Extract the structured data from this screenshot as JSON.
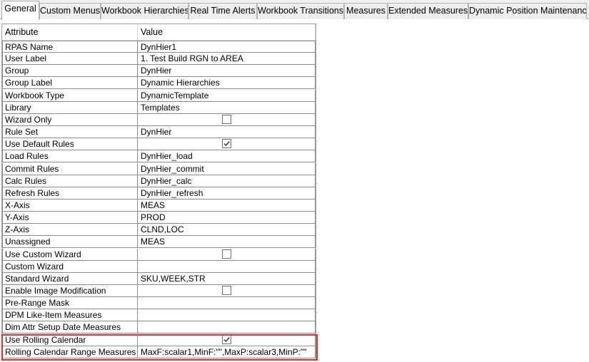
{
  "tabs": [
    {
      "label": "General",
      "active": true
    },
    {
      "label": "Custom Menus",
      "active": false
    },
    {
      "label": "Workbook Hierarchies",
      "active": false
    },
    {
      "label": "Real Time Alerts",
      "active": false
    },
    {
      "label": "Workbook Transitions",
      "active": false
    },
    {
      "label": "Measures",
      "active": false
    },
    {
      "label": "Extended Measures",
      "active": false
    },
    {
      "label": "Dynamic Position Maintenance",
      "active": false
    }
  ],
  "grid": {
    "columns": [
      "Attribute",
      "Value"
    ],
    "rows": [
      {
        "attribute": "RPAS Name",
        "value": "DynHier1"
      },
      {
        "attribute": "User Label",
        "value": "1.  Test Build RGN to AREA"
      },
      {
        "attribute": "Group",
        "value": "DynHier"
      },
      {
        "attribute": "Group Label",
        "value": "Dynamic Hierarchies"
      },
      {
        "attribute": "Workbook Type",
        "value": "DynamicTemplate"
      },
      {
        "attribute": "Library",
        "value": "Templates"
      },
      {
        "attribute": "Wizard Only",
        "checkbox": true,
        "checked": false
      },
      {
        "attribute": "Rule Set",
        "value": "DynHier"
      },
      {
        "attribute": "Use Default Rules",
        "checkbox": true,
        "checked": true
      },
      {
        "attribute": "Load Rules",
        "value": "DynHier_load"
      },
      {
        "attribute": "Commit Rules",
        "value": "DynHier_commit"
      },
      {
        "attribute": "Calc Rules",
        "value": "DynHier_calc"
      },
      {
        "attribute": "Refresh Rules",
        "value": "DynHier_refresh"
      },
      {
        "attribute": "X-Axis",
        "value": "MEAS"
      },
      {
        "attribute": "Y-Axis",
        "value": "PROD"
      },
      {
        "attribute": "Z-Axis",
        "value": "CLND,LOC"
      },
      {
        "attribute": "Unassigned",
        "value": "MEAS"
      },
      {
        "attribute": "Use Custom Wizard",
        "checkbox": true,
        "checked": false
      },
      {
        "attribute": "Custom Wizard",
        "value": ""
      },
      {
        "attribute": "Standard Wizard",
        "value": "SKU,WEEK,STR"
      },
      {
        "attribute": "Enable Image Modification",
        "checkbox": true,
        "checked": false
      },
      {
        "attribute": "Pre-Range Mask",
        "value": ""
      },
      {
        "attribute": "DPM Like-Item Measures",
        "value": ""
      },
      {
        "attribute": "Dim Attr Setup Date Measures",
        "value": ""
      },
      {
        "attribute": "Use Rolling Calendar",
        "checkbox": true,
        "checked": true
      },
      {
        "attribute": "Rolling Calendar Range Measures",
        "value": "MaxF:scalar1,MinF:\"\",MaxP:scalar3,MinP:\"\""
      }
    ]
  },
  "colors": {
    "highlight": "#e0302c",
    "tabbar_bg": "#f0f0f0",
    "cell_border": "#8c8c8c"
  }
}
